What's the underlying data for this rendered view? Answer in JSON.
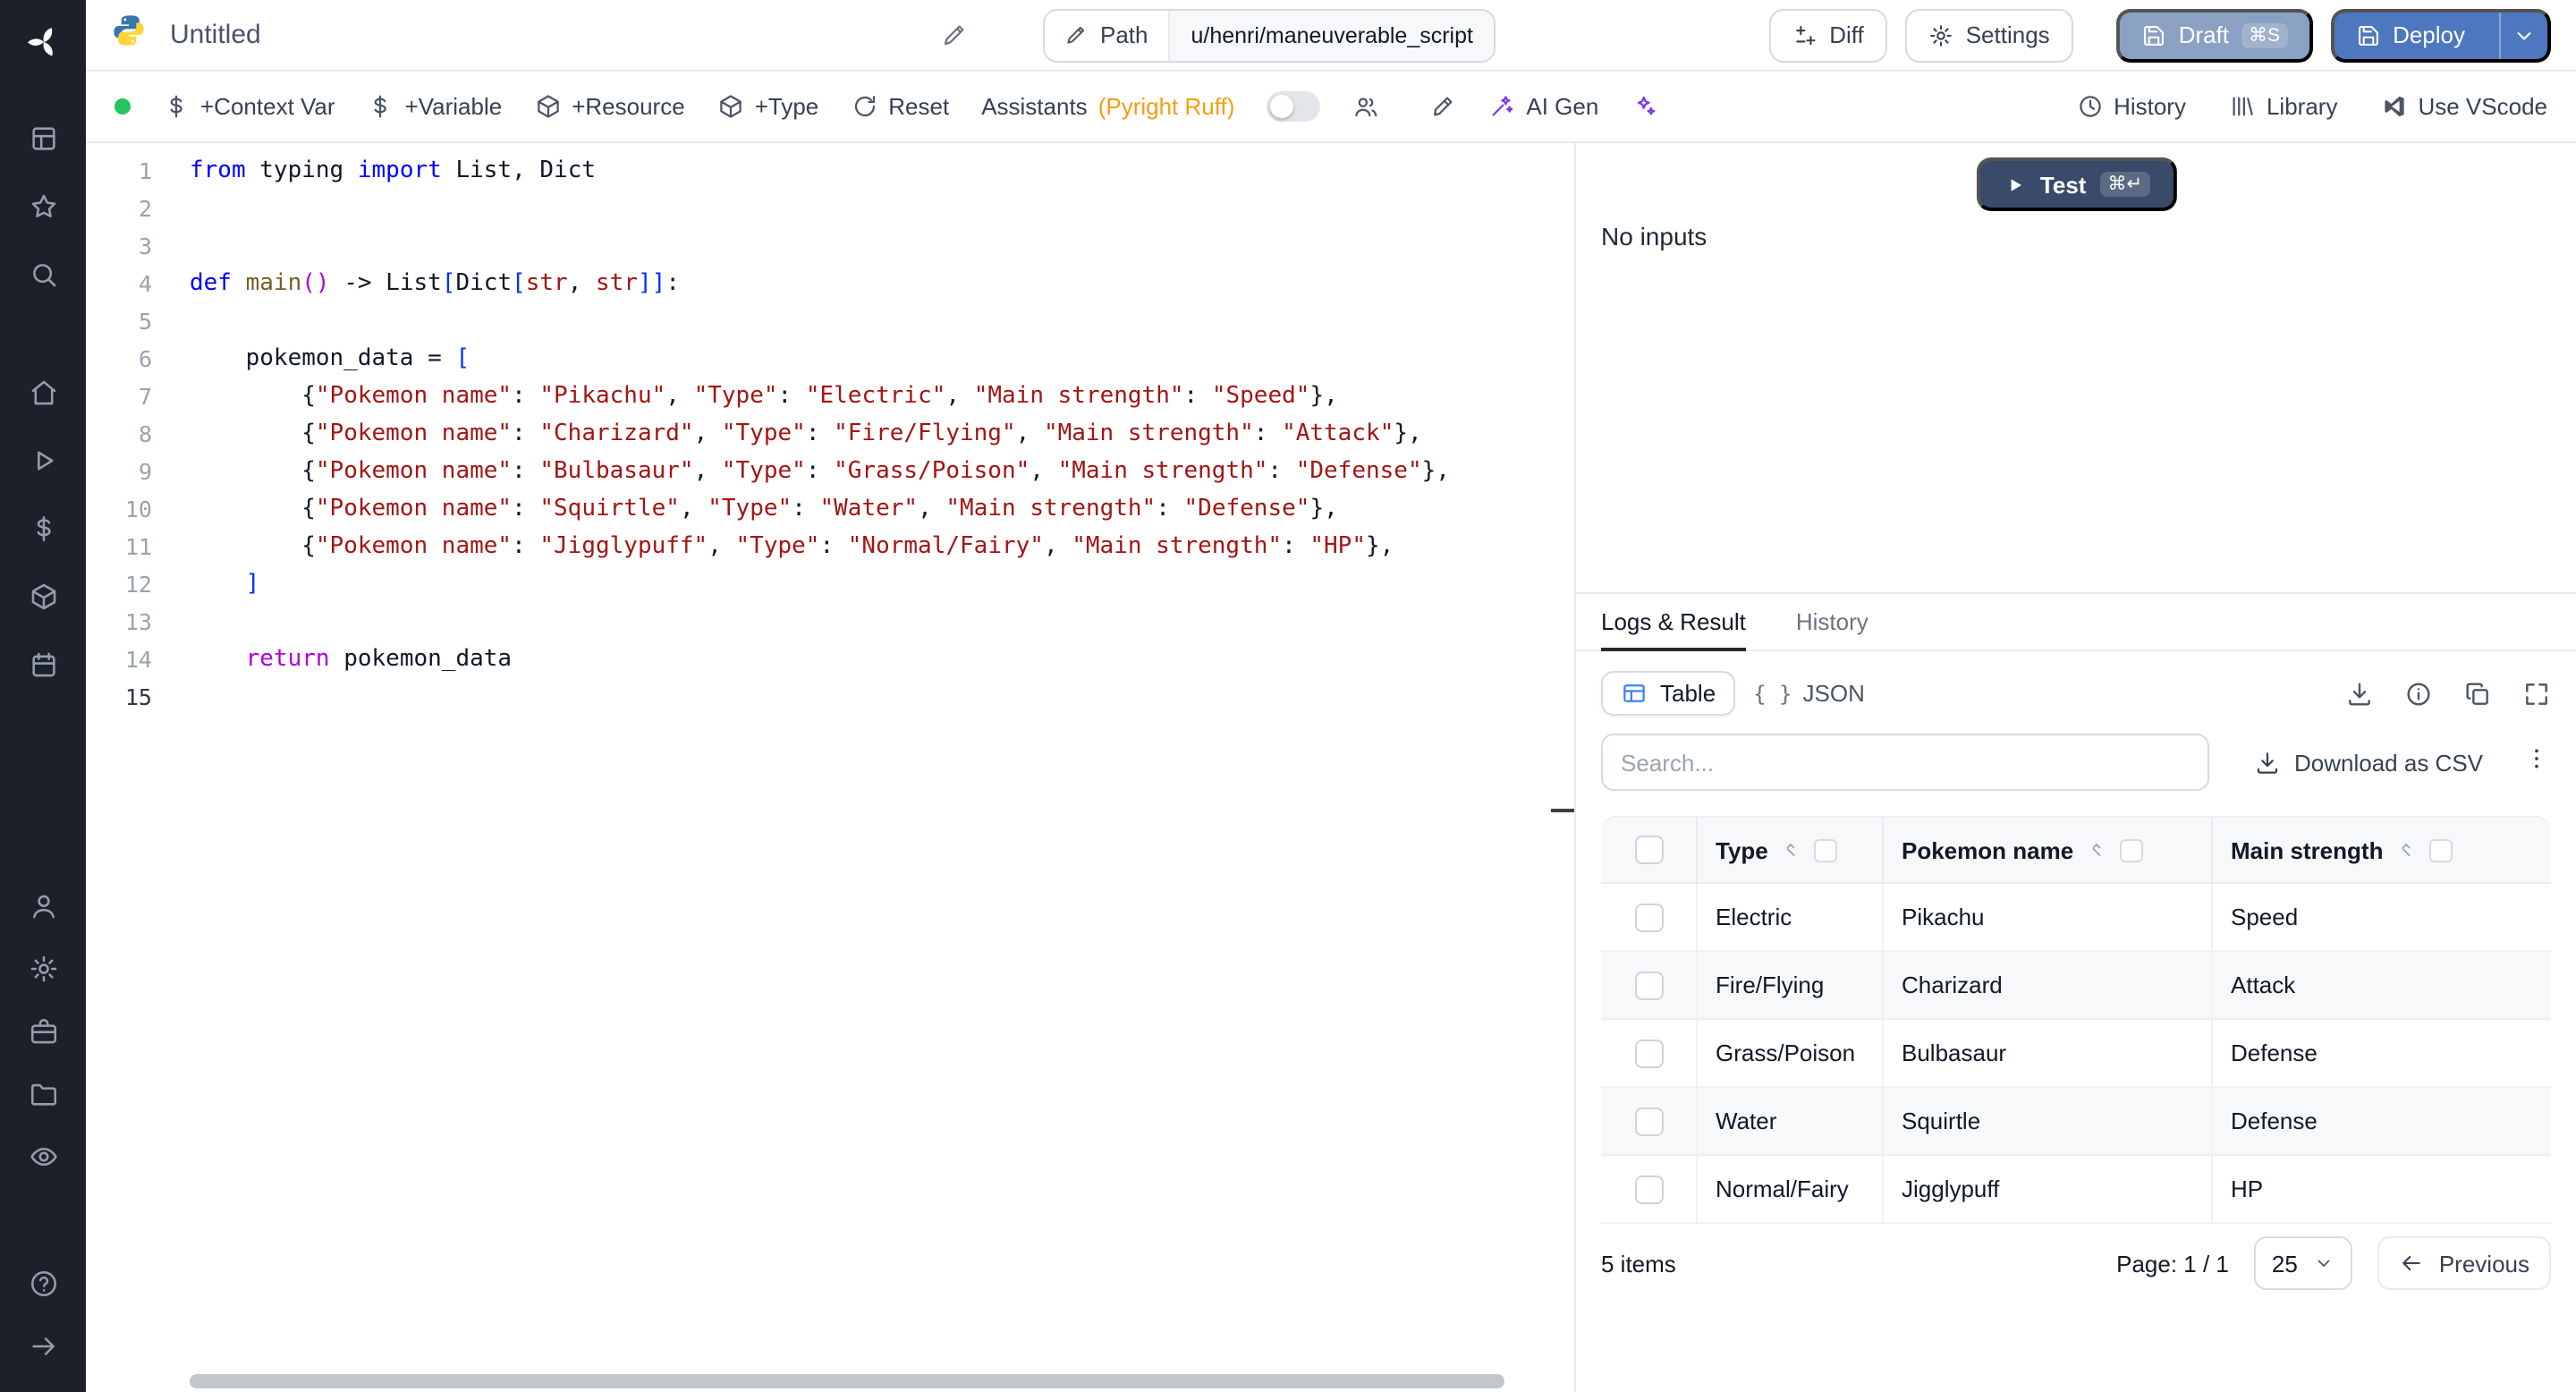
{
  "topbar": {
    "title": "Untitled",
    "path_label": "Path",
    "path_value": "u/henri/maneuverable_script",
    "diff": "Diff",
    "settings": "Settings",
    "draft": "Draft",
    "draft_shortcut": "⌘S",
    "deploy": "Deploy"
  },
  "toolbar": {
    "context_var": "+Context Var",
    "variable": "+Variable",
    "resource": "+Resource",
    "type": "+Type",
    "reset": "Reset",
    "assistants": "Assistants",
    "assistants_detail": "(Pyright Ruff)",
    "ai_gen": "AI Gen",
    "history": "History",
    "library": "Library",
    "vscode": "Use VScode"
  },
  "sidebar": {
    "groups": [
      [
        "grid-icon",
        "star-icon",
        "search-icon"
      ],
      [
        "home-icon",
        "play-icon",
        "dollar-icon",
        "cube-icon",
        "calendar-icon"
      ],
      [
        "user-icon",
        "gear-icon",
        "briefcase-icon",
        "folder-icon",
        "eye-icon"
      ],
      [
        "help-icon",
        "arrow-right-icon"
      ]
    ]
  },
  "editor": {
    "active_line": 15,
    "lines": [
      [
        [
          "k",
          "from"
        ],
        [
          "d",
          " typing "
        ],
        [
          "k",
          "import"
        ],
        [
          "d",
          " List, Dict"
        ]
      ],
      [],
      [],
      [
        [
          "k",
          "def"
        ],
        [
          "d",
          " "
        ],
        [
          "fn",
          "main"
        ],
        [
          "p",
          "()"
        ],
        [
          "d",
          " -> List"
        ],
        [
          "sb",
          "["
        ],
        [
          "d",
          "Dict"
        ],
        [
          "sb",
          "["
        ],
        [
          "s",
          "str"
        ],
        [
          "d",
          ", "
        ],
        [
          "s",
          "str"
        ],
        [
          "sb",
          "]]"
        ],
        [
          "d",
          ":"
        ]
      ],
      [],
      [
        [
          "d",
          "    pokemon_data = "
        ],
        [
          "sb",
          "["
        ]
      ],
      [
        [
          "d",
          "        {"
        ],
        [
          "s",
          "\"Pokemon name\""
        ],
        [
          "d",
          ": "
        ],
        [
          "s",
          "\"Pikachu\""
        ],
        [
          "d",
          ", "
        ],
        [
          "s",
          "\"Type\""
        ],
        [
          "d",
          ": "
        ],
        [
          "s",
          "\"Electric\""
        ],
        [
          "d",
          ", "
        ],
        [
          "s",
          "\"Main strength\""
        ],
        [
          "d",
          ": "
        ],
        [
          "s",
          "\"Speed\""
        ],
        [
          "d",
          "},"
        ]
      ],
      [
        [
          "d",
          "        {"
        ],
        [
          "s",
          "\"Pokemon name\""
        ],
        [
          "d",
          ": "
        ],
        [
          "s",
          "\"Charizard\""
        ],
        [
          "d",
          ", "
        ],
        [
          "s",
          "\"Type\""
        ],
        [
          "d",
          ": "
        ],
        [
          "s",
          "\"Fire/Flying\""
        ],
        [
          "d",
          ", "
        ],
        [
          "s",
          "\"Main strength\""
        ],
        [
          "d",
          ": "
        ],
        [
          "s",
          "\"Attack\""
        ],
        [
          "d",
          "},"
        ]
      ],
      [
        [
          "d",
          "        {"
        ],
        [
          "s",
          "\"Pokemon name\""
        ],
        [
          "d",
          ": "
        ],
        [
          "s",
          "\"Bulbasaur\""
        ],
        [
          "d",
          ", "
        ],
        [
          "s",
          "\"Type\""
        ],
        [
          "d",
          ": "
        ],
        [
          "s",
          "\"Grass/Poison\""
        ],
        [
          "d",
          ", "
        ],
        [
          "s",
          "\"Main strength\""
        ],
        [
          "d",
          ": "
        ],
        [
          "s",
          "\"Defense\""
        ],
        [
          "d",
          "},"
        ]
      ],
      [
        [
          "d",
          "        {"
        ],
        [
          "s",
          "\"Pokemon name\""
        ],
        [
          "d",
          ": "
        ],
        [
          "s",
          "\"Squirtle\""
        ],
        [
          "d",
          ", "
        ],
        [
          "s",
          "\"Type\""
        ],
        [
          "d",
          ": "
        ],
        [
          "s",
          "\"Water\""
        ],
        [
          "d",
          ", "
        ],
        [
          "s",
          "\"Main strength\""
        ],
        [
          "d",
          ": "
        ],
        [
          "s",
          "\"Defense\""
        ],
        [
          "d",
          "},"
        ]
      ],
      [
        [
          "d",
          "        {"
        ],
        [
          "s",
          "\"Pokemon name\""
        ],
        [
          "d",
          ": "
        ],
        [
          "s",
          "\"Jigglypuff\""
        ],
        [
          "d",
          ", "
        ],
        [
          "s",
          "\"Type\""
        ],
        [
          "d",
          ": "
        ],
        [
          "s",
          "\"Normal/Fairy\""
        ],
        [
          "d",
          ", "
        ],
        [
          "s",
          "\"Main strength\""
        ],
        [
          "d",
          ": "
        ],
        [
          "s",
          "\"HP\""
        ],
        [
          "d",
          "},"
        ]
      ],
      [
        [
          "d",
          "    "
        ],
        [
          "sb",
          "]"
        ]
      ],
      [],
      [
        [
          "d",
          "    "
        ],
        [
          "kp",
          "return"
        ],
        [
          "d",
          " pokemon_data"
        ]
      ],
      []
    ]
  },
  "inputs_panel": {
    "test": "Test",
    "test_shortcut": "⌘↵",
    "empty": "No inputs"
  },
  "result_panel": {
    "tabs": [
      {
        "label": "Logs & Result",
        "active": true
      },
      {
        "label": "History",
        "active": false
      }
    ],
    "toggle_table": "Table",
    "toggle_json": "JSON",
    "search_placeholder": "Search...",
    "download_csv": "Download as CSV",
    "table": {
      "columns": [
        "Type",
        "Pokemon name",
        "Main strength"
      ],
      "rows": [
        [
          "Electric",
          "Pikachu",
          "Speed"
        ],
        [
          "Fire/Flying",
          "Charizard",
          "Attack"
        ],
        [
          "Grass/Poison",
          "Bulbasaur",
          "Defense"
        ],
        [
          "Water",
          "Squirtle",
          "Defense"
        ],
        [
          "Normal/Fairy",
          "Jigglypuff",
          "HP"
        ]
      ]
    },
    "footer": {
      "items": "5 items",
      "page": "Page: 1 / 1",
      "page_size": "25",
      "previous": "Previous"
    }
  },
  "colors": {
    "deploy_blue": "#4d77be",
    "draft_blue": "#8ba1c3",
    "test_navy": "#394b69",
    "status_green": "#22c55e",
    "table_icon_blue": "#3b82f6",
    "assistant_orange": "#f59e0b",
    "ai_purple": "#7c3aed"
  }
}
